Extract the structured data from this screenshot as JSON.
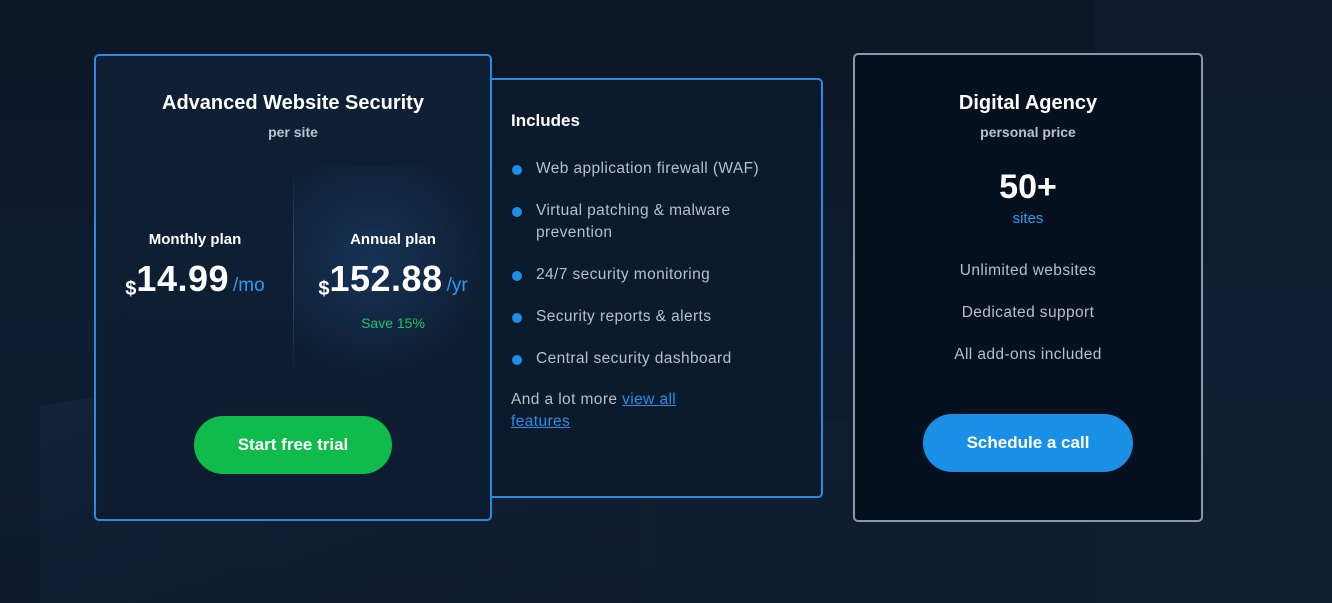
{
  "main_plan": {
    "title": "Advanced Website Security",
    "subtitle": "per site",
    "monthly": {
      "label": "Monthly plan",
      "currency": "$",
      "amount": "14.99",
      "period": "/mo"
    },
    "annual": {
      "label": "Annual plan",
      "currency": "$",
      "amount": "152.88",
      "period": "/yr",
      "savings": "Save 15%"
    },
    "cta": "Start free trial"
  },
  "includes": {
    "title": "Includes",
    "features": [
      "Web application firewall (WAF)",
      "Virtual patching & malware prevention",
      "24/7 security monitoring",
      "Security reports & alerts",
      "Central security dashboard"
    ],
    "more_text": "And a lot more",
    "more_link": "view all features"
  },
  "agency": {
    "title": "Digital Agency",
    "subtitle": "personal price",
    "count": "50+",
    "unit": "sites",
    "items": [
      "Unlimited websites",
      "Dedicated support",
      "All add-ons included"
    ],
    "cta": "Schedule a call"
  },
  "colors": {
    "accent_blue": "#1a8fe6",
    "accent_green": "#0fbb4a",
    "savings_green": "#1ec468",
    "card_border": "#2b8be0",
    "agency_border": "#8a99aa"
  }
}
